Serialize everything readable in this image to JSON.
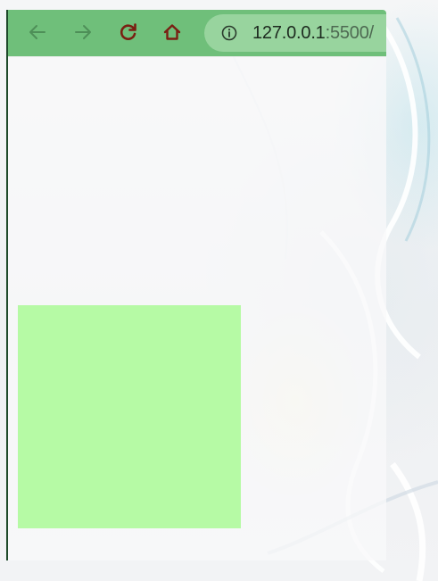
{
  "browser": {
    "toolbar": {
      "background_color": "#6fbf7a",
      "back_icon": "arrow-left-icon",
      "forward_icon": "arrow-right-icon",
      "reload_icon": "reload-icon",
      "home_icon": "home-icon",
      "icon_color_dim": "#4e8f58",
      "icon_color_active": "#7a1f12"
    },
    "address_bar": {
      "info_icon": "info-circle-icon",
      "url_host": "127.0.0.1",
      "url_rest": ":5500/"
    }
  },
  "page": {
    "background_color": "#f8f8fa",
    "square": {
      "color": "#aafa96"
    }
  }
}
